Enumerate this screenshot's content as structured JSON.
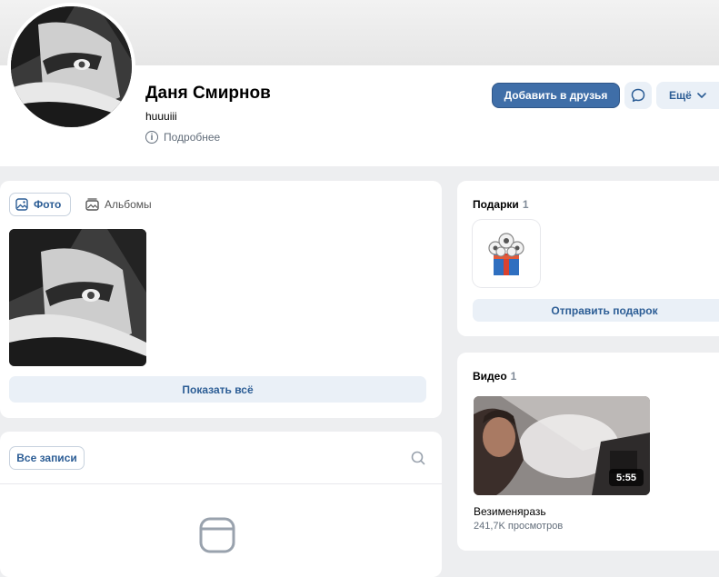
{
  "profile": {
    "name": "Даня Смирнов",
    "status": "huuuiii",
    "more_info_label": "Подробнее",
    "add_friend_label": "Добавить в друзья",
    "more_label": "Ещё"
  },
  "photos": {
    "tabs": [
      {
        "label": "Фото",
        "icon": "image-icon",
        "active": true
      },
      {
        "label": "Альбомы",
        "icon": "album-icon",
        "active": false
      }
    ],
    "show_all_label": "Показать всё"
  },
  "posts": {
    "all_posts_label": "Все записи"
  },
  "gifts": {
    "title": "Подарки",
    "count": "1",
    "send_gift_label": "Отправить подарок"
  },
  "videos": {
    "title": "Видео",
    "count": "1",
    "items": [
      {
        "title": "Везименяразь",
        "views": "241,7K просмотров",
        "duration": "5:55"
      }
    ]
  },
  "colors": {
    "accent": "#3f6ea8",
    "link": "#2c5d95",
    "page_bg": "#edeef0",
    "button_secondary_bg": "#eaf0f7"
  }
}
